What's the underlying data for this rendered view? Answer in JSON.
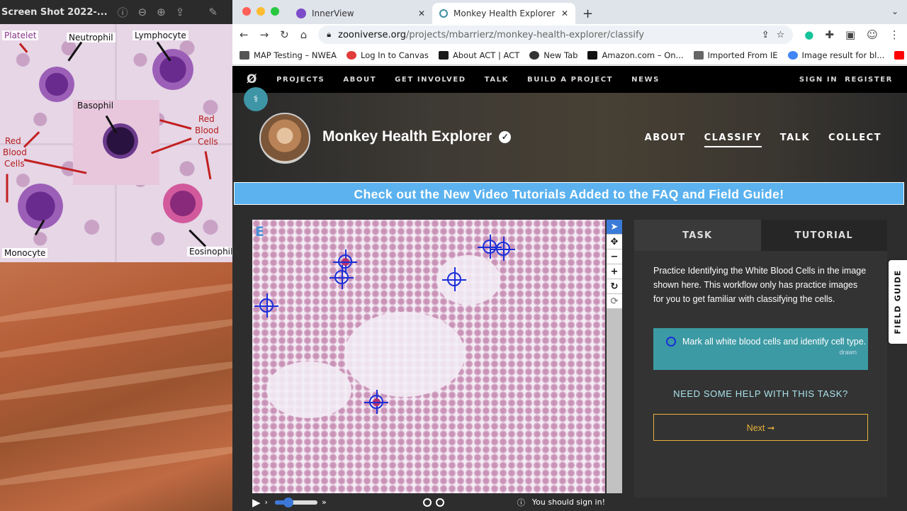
{
  "preview": {
    "title": "Screen Shot 2022-...",
    "labels": {
      "platelet": "Platelet",
      "neutrophil": "Neutrophil",
      "lymphocyte": "Lymphocyte",
      "basophil": "Basophil",
      "red_left_1": "Red",
      "red_left_2": "Blood",
      "red_left_3": "Cells",
      "red_right_1": "Red",
      "red_right_2": "Blood",
      "red_right_3": "Cells",
      "monocyte": "Monocyte",
      "eosinophil": "Eosinophil"
    }
  },
  "browser": {
    "tabs": [
      {
        "label": "InnerView",
        "close": "✕"
      },
      {
        "label": "Monkey Health Explorer » Clas",
        "close": "✕"
      }
    ],
    "new_tab": "+",
    "url_host": "zooniverse.org",
    "url_path": "/projects/mbarrierz/monkey-health-explorer/classify",
    "bookmarks": [
      "MAP Testing – NWEA",
      "Log In to Canvas",
      "About ACT | ACT",
      "New Tab",
      "Amazon.com – On...",
      "Imported From IE",
      "Image result for bl..."
    ],
    "bookmark_more": "»"
  },
  "site": {
    "nav": [
      "PROJECTS",
      "ABOUT",
      "GET INVOLVED",
      "TALK",
      "BUILD A PROJECT",
      "NEWS"
    ],
    "sign_in": "SIGN IN",
    "register": "REGISTER",
    "project_title": "Monkey Health Explorer",
    "project_nav": [
      "ABOUT",
      "CLASSIFY",
      "TALK",
      "COLLECT"
    ],
    "banner": "Check out the New Video Tutorials Added to the FAQ and Field Guide!",
    "subject_letter": "E",
    "sign_in_note": "You should sign in!"
  },
  "task": {
    "tab_task": "TASK",
    "tab_tutorial": "TUTORIAL",
    "instructions": "Practice Identifying the White Blood Cells in the image shown here. This workflow only has practice images for you to get familiar with classifying the cells.",
    "choice_label": "Mark all white blood cells and identify cell type.",
    "drawn_count": "7",
    "drawn_label": "drawn",
    "help": "NEED SOME HELP WITH THIS TASK?",
    "next": "Next ➞",
    "field_guide": "FIELD GUIDE"
  },
  "colors": {
    "accent_teal": "#3c9aa4",
    "banner_blue": "#5bb2ef",
    "next_gold": "#e8b33a",
    "marker_blue": "#1b2fd8"
  }
}
